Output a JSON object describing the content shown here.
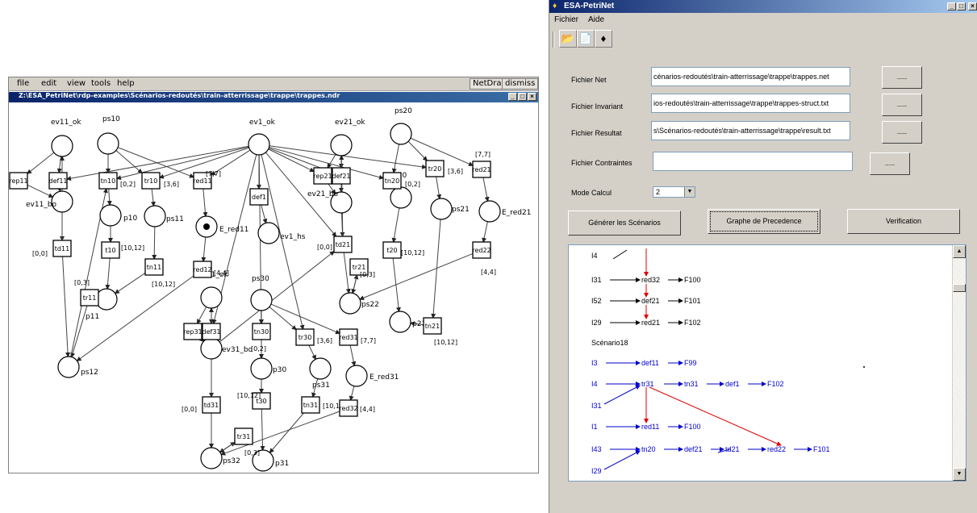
{
  "netdraw": {
    "menu": [
      "file",
      "edit",
      "view",
      "tools",
      "help"
    ],
    "mode_button": "NetDraw",
    "dismiss_button": "dismiss",
    "window_title": "Z:\\ESA_PetriNet\\rdp-examples\\Scénarios-redoutés\\train-atterrissage\\trappe\\trappes.ndr",
    "places": [
      {
        "label": "ev11_ok"
      },
      {
        "label": "ps10"
      },
      {
        "label": "ev1_ok"
      },
      {
        "label": "ev21_ok"
      },
      {
        "label": "ps20"
      },
      {
        "label": "ev11_bo"
      },
      {
        "label": "p10"
      },
      {
        "label": "ps11"
      },
      {
        "label": "E_red11",
        "marked": true
      },
      {
        "label": "ev21_bo"
      },
      {
        "label": "p20"
      },
      {
        "label": "ps21"
      },
      {
        "label": "E_red21"
      },
      {
        "label": "ev1_hs"
      },
      {
        "label": "ps12"
      },
      {
        "label": "p11"
      },
      {
        "label": "ps22"
      },
      {
        "label": "p21"
      },
      {
        "label": "ev31_ok"
      },
      {
        "label": "ps30"
      },
      {
        "label": "ev31_bo"
      },
      {
        "label": "p30"
      },
      {
        "label": "ps31"
      },
      {
        "label": "E_red31"
      },
      {
        "label": "ps32"
      },
      {
        "label": "p31"
      }
    ],
    "transitions": [
      {
        "label": "rep11"
      },
      {
        "label": "def11"
      },
      {
        "label": "tn10",
        "interval": "[0,2]"
      },
      {
        "label": "tr10",
        "interval": "[3,6]"
      },
      {
        "label": "red11",
        "interval": "[7,7]"
      },
      {
        "label": "def1"
      },
      {
        "label": "rep21"
      },
      {
        "label": "def21"
      },
      {
        "label": "tn20",
        "interval": "[0,2]"
      },
      {
        "label": "tr20",
        "interval": "[3,6]"
      },
      {
        "label": "red21",
        "interval": "[7,7]"
      },
      {
        "label": "td11",
        "interval": "[0,0]"
      },
      {
        "label": "t10",
        "interval": "[10,12]"
      },
      {
        "label": "tn11",
        "interval": "[10,12]"
      },
      {
        "label": "red12",
        "interval": "[4,4]"
      },
      {
        "label": "tr11",
        "interval": "[0,3]"
      },
      {
        "label": "td21",
        "interval": "[0,0]"
      },
      {
        "label": "t20",
        "interval": "[10,12]"
      },
      {
        "label": "tr21",
        "interval": "[0,3]"
      },
      {
        "label": "red22",
        "interval": "[4,4]"
      },
      {
        "label": "tn21",
        "interval": "[10,12]"
      },
      {
        "label": "rep31"
      },
      {
        "label": "def31"
      },
      {
        "label": "tn30",
        "interval": "[0,2]"
      },
      {
        "label": "tr30",
        "interval": "[3,6]"
      },
      {
        "label": "red31",
        "interval": "[7,7]"
      },
      {
        "label": "td31",
        "interval": "[0,0]"
      },
      {
        "label": "t30",
        "interval": "[10,12]"
      },
      {
        "label": "tn31",
        "interval": "[10,12]"
      },
      {
        "label": "red32",
        "interval": "[4,4]"
      },
      {
        "label": "tr31",
        "interval": "[0,3]"
      }
    ]
  },
  "esa": {
    "title": "ESA-PetriNet",
    "menu": [
      "Fichier",
      "Aide"
    ],
    "toolbar_icons": [
      "open-folder-icon",
      "save-icon",
      "run-icon"
    ],
    "fields": [
      {
        "label": "Fichier Net",
        "value": "cénarios-redoutés\\train-atterrissage\\trappe\\trappes.net",
        "button": "....."
      },
      {
        "label": "Fichier Invariant",
        "value": "ios-redoutés\\train-atterrissage\\trappe\\trappes-struct.txt",
        "button": "....."
      },
      {
        "label": "Fichier Resultat",
        "value": "s\\Scénarios-redoutés\\train-atterrissage\\trappe\\result.txt",
        "button": "....."
      },
      {
        "label": "Fichier Contraintes",
        "value": "",
        "button": "....."
      }
    ],
    "mode": {
      "label": "Mode Calcul",
      "value": "2"
    },
    "buttons": {
      "generer": "Générer les Scénarios",
      "graphe": "Graphe de Precedence",
      "verification": "Verification"
    },
    "colors": {
      "black_text": "#000000",
      "blue_text": "#0000cc",
      "red_arrow": "#dd0000"
    },
    "scenarios": {
      "prev_rows": [
        [
          "I4"
        ],
        [
          "I31",
          "red32",
          "F100"
        ],
        [
          "I52",
          "def21",
          "F101"
        ],
        [
          "I29",
          "red21",
          "F102"
        ]
      ],
      "header": "Scénario18",
      "rows": [
        [
          "I3",
          "def11",
          "F99"
        ],
        [
          "I4",
          "tr31",
          "tn31",
          "def1",
          "F102"
        ],
        [
          "I31"
        ],
        [
          "I1",
          "red11",
          "F100"
        ],
        [
          "I43",
          "tn20",
          "def21",
          "td21",
          "red22",
          "F101"
        ],
        [
          "I29"
        ]
      ]
    }
  }
}
